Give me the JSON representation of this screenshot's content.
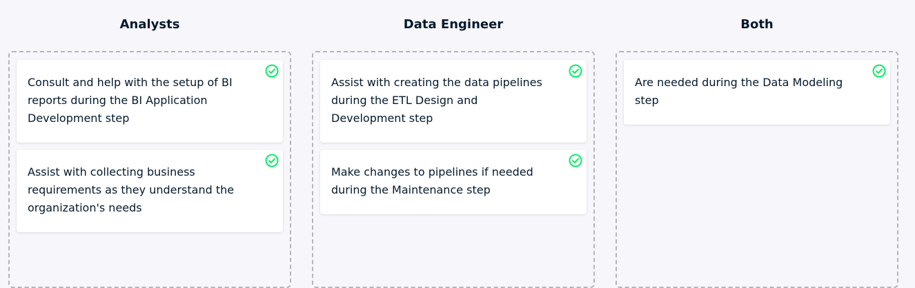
{
  "columns": [
    {
      "title": "Analysts",
      "cards": [
        {
          "text": "Consult and help with the setup of BI reports during the BI Application Development step",
          "status": "correct"
        },
        {
          "text": "Assist with collecting business requirements as they understand the organization's needs",
          "status": "correct"
        }
      ]
    },
    {
      "title": "Data Engineer",
      "cards": [
        {
          "text": "Assist with creating the data pipelines during the ETL Design and Development step",
          "status": "correct"
        },
        {
          "text": "Make changes to pipelines if needed during the Maintenance step",
          "status": "correct"
        }
      ]
    },
    {
      "title": "Both",
      "cards": [
        {
          "text": "Are needed during the Data Modeling step",
          "status": "correct"
        }
      ]
    }
  ],
  "colors": {
    "background": "#f7f7fb",
    "text": "#05192d",
    "dashed_border": "#b4b5bb",
    "check_green": "#03ef62"
  },
  "icons": {
    "card_status": "check-circle-icon"
  }
}
